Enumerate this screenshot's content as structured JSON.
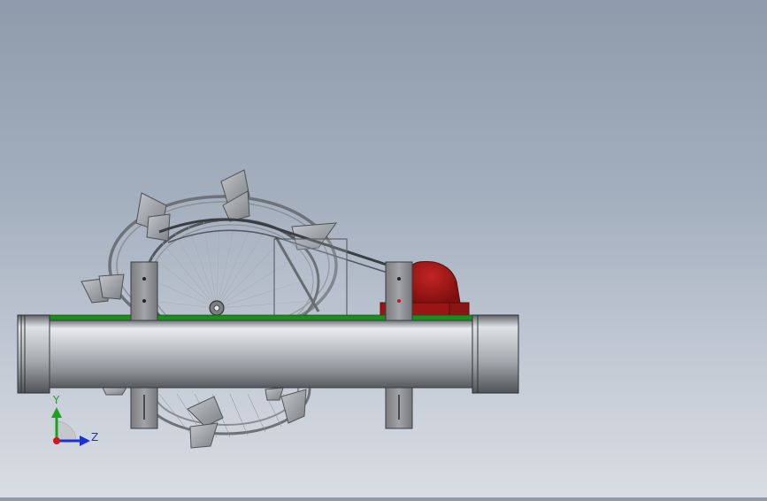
{
  "viewport": {
    "background_top": "#8f9aab",
    "background_bottom": "#d9dde3"
  },
  "triad": {
    "y_label": "Y",
    "z_label": "Z",
    "y_color": "#1aa31a",
    "z_color": "#1f2fd6",
    "origin_color": "#d01818"
  },
  "colors": {
    "pipe": "#b9bdc2",
    "deck": "#1f8a1f",
    "bracket": "#8b8d90",
    "motor": "#a61818",
    "frame": "#6f7378",
    "paddle": "#9fa3a8"
  }
}
